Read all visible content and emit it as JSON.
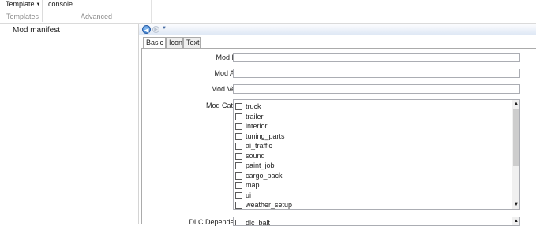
{
  "ribbon": {
    "template_label": "Template",
    "console_label": "console",
    "groups": [
      "Templates",
      "Advanced"
    ]
  },
  "sidebar": {
    "items": [
      {
        "label": "Mod manifest"
      }
    ]
  },
  "tabs": [
    {
      "label": "Basic",
      "active": true
    },
    {
      "label": "Icon",
      "active": false
    },
    {
      "label": "Text",
      "active": false
    }
  ],
  "form": {
    "mod_name_label": "Mod Name:",
    "mod_author_label": "Mod Author:",
    "mod_version_label": "Mod Version:",
    "mod_name_value": "",
    "mod_author_value": "",
    "mod_version_value": "",
    "mod_category_label": "Mod Category:",
    "categories": [
      "truck",
      "trailer",
      "interior",
      "tuning_parts",
      "ai_traffic",
      "sound",
      "paint_job",
      "cargo_pack",
      "map",
      "ui",
      "weather_setup"
    ],
    "dlc_label": "DLC Dependencies:",
    "dlc_items": [
      "dlc_balt"
    ]
  },
  "icons": {
    "back": "back-arrow-icon",
    "forward": "forward-arrow-icon",
    "dropdown": "chevron-down-icon",
    "scroll_up": "scroll-up-icon",
    "scroll_down": "scroll-down-icon"
  }
}
